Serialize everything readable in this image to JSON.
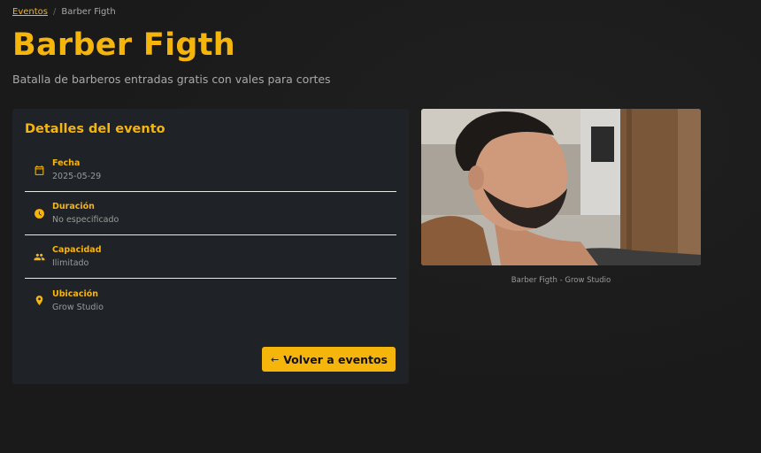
{
  "breadcrumb": {
    "parent": "Eventos",
    "current": "Barber Figth"
  },
  "page": {
    "title": "Barber Figth",
    "subtitle": "Batalla de barberos entradas gratis con vales para cortes"
  },
  "details": {
    "heading": "Detalles del evento",
    "items": [
      {
        "icon": "calendar-icon",
        "label": "Fecha",
        "value": "2025-05-29"
      },
      {
        "icon": "clock-icon",
        "label": "Duración",
        "value": "No especificado"
      },
      {
        "icon": "people-icon",
        "label": "Capacidad",
        "value": "Ilimitado"
      },
      {
        "icon": "location-pin-icon",
        "label": "Ubicación",
        "value": "Grow Studio"
      }
    ],
    "back_button": "Volver a eventos"
  },
  "image": {
    "caption": "Barber Figth - Grow Studio"
  },
  "colors": {
    "accent": "#f5b50a",
    "background": "#1a1a1a",
    "card": "#1f2227"
  }
}
